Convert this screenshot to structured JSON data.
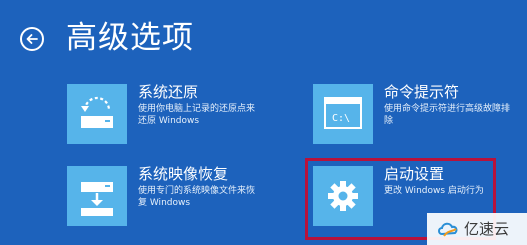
{
  "header": {
    "title": "高级选项"
  },
  "options": [
    {
      "id": "system-restore",
      "title": "系统还原",
      "description": "使用你电脑上记录的还原点来还原 Windows",
      "icon": "system-restore-icon"
    },
    {
      "id": "command-prompt",
      "title": "命令提示符",
      "description": "使用命令提示符进行高级故障排除",
      "icon": "command-prompt-icon"
    },
    {
      "id": "system-image-recovery",
      "title": "系统映像恢复",
      "description": "使用专门的系统映像文件来恢复 Windows",
      "icon": "system-image-icon"
    },
    {
      "id": "startup-settings",
      "title": "启动设置",
      "description": "更改 Windows 启动行为",
      "icon": "gear-icon"
    }
  ],
  "watermark": {
    "text": "亿速云"
  },
  "colors": {
    "background": "#1d62bc",
    "tile": "#56b4ea",
    "highlight": "#b8123b"
  }
}
